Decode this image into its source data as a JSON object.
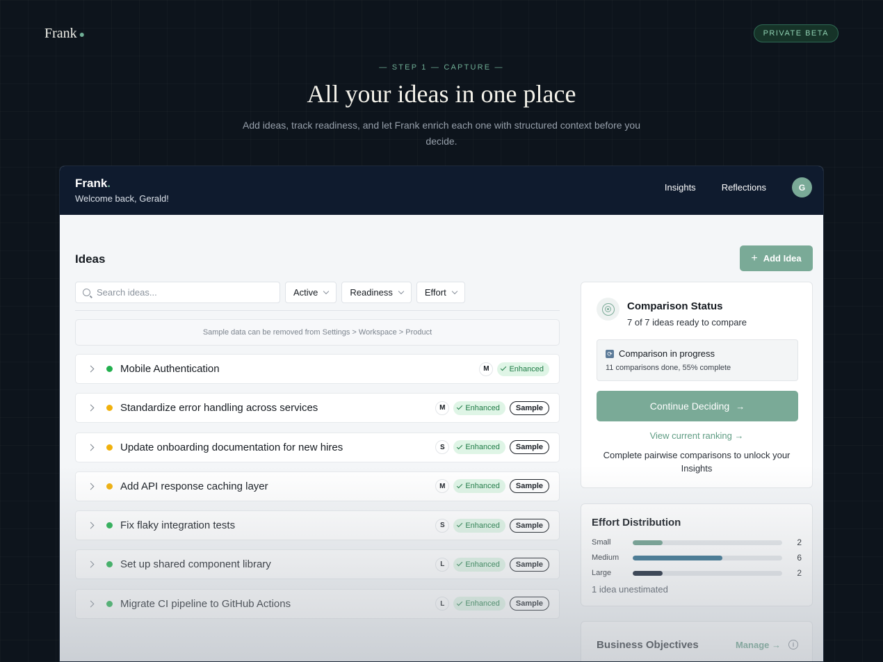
{
  "site": {
    "brand": "Frank",
    "beta_label": "PRIVATE BETA"
  },
  "hero": {
    "eyebrow": "— STEP 1 — CAPTURE —",
    "title": "All your ideas in one place",
    "subtitle": "Add ideas, track readiness, and let Frank enrich each one with structured context before you decide."
  },
  "app": {
    "brand": "Frank",
    "brand_dot": ".",
    "welcome": "Welcome back, Gerald!",
    "nav": [
      "Insights",
      "Reflections"
    ],
    "avatar_initial": "G"
  },
  "ideas": {
    "title": "Ideas",
    "add_label": "Add Idea",
    "search_placeholder": "Search ideas...",
    "filters": [
      "Active",
      "Readiness",
      "Effort"
    ],
    "notice": "Sample data can be removed from Settings > Workspace > Product",
    "items": [
      {
        "title": "Mobile Authentication",
        "status": "green",
        "size": "M",
        "enhanced": "Enhanced",
        "sample": ""
      },
      {
        "title": "Standardize error handling across services",
        "status": "yellow",
        "size": "M",
        "enhanced": "Enhanced",
        "sample": "Sample"
      },
      {
        "title": "Update onboarding documentation for new hires",
        "status": "yellow",
        "size": "S",
        "enhanced": "Enhanced",
        "sample": "Sample"
      },
      {
        "title": "Add API response caching layer",
        "status": "yellow",
        "size": "M",
        "enhanced": "Enhanced",
        "sample": "Sample"
      },
      {
        "title": "Fix flaky integration tests",
        "status": "green",
        "size": "S",
        "enhanced": "Enhanced",
        "sample": "Sample"
      },
      {
        "title": "Set up shared component library",
        "status": "green",
        "size": "L",
        "enhanced": "Enhanced",
        "sample": "Sample"
      },
      {
        "title": "Migrate CI pipeline to GitHub Actions",
        "status": "green",
        "size": "L",
        "enhanced": "Enhanced",
        "sample": "Sample"
      }
    ]
  },
  "comparison": {
    "title": "Comparison Status",
    "subtitle": "7 of 7 ideas ready to compare",
    "progress_title": "Comparison in progress",
    "progress_detail": "11 comparisons done, 55% complete",
    "continue_label": "Continue Deciding",
    "ranking_link": "View current ranking →",
    "unlock_text": "Complete pairwise comparisons to unlock your Insights"
  },
  "effort": {
    "title": "Effort Distribution",
    "rows": [
      {
        "label": "Small",
        "count": 2,
        "fraction": 0.2,
        "color": "#6c9e8c"
      },
      {
        "label": "Medium",
        "count": 6,
        "fraction": 0.6,
        "color": "#2d6b8a"
      },
      {
        "label": "Large",
        "count": 2,
        "fraction": 0.2,
        "color": "#0f1b2e"
      }
    ],
    "unestimated": "1 idea unestimated"
  },
  "objectives": {
    "title": "Business Objectives",
    "manage_label": "Manage"
  },
  "colors": {
    "accent": "#7aaa97",
    "status_green": "#22b04e",
    "status_yellow": "#f1b10c",
    "header_bg": "#0f1b2e"
  }
}
